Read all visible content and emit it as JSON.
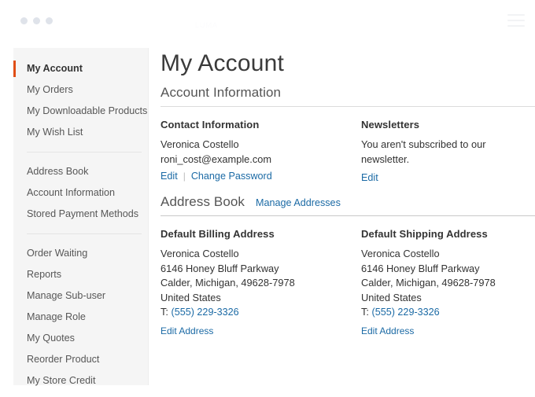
{
  "window": {
    "dots": [
      "dot-1",
      "dot-2",
      "dot-3"
    ],
    "brand_watermark": "LUMA",
    "menu_icon": "hamburger-menu-icon"
  },
  "sidebar": {
    "groups": [
      {
        "items": [
          {
            "label": "My Account",
            "current": true
          },
          {
            "label": "My Orders",
            "current": false
          },
          {
            "label": "My Downloadable Products",
            "current": false
          },
          {
            "label": "My Wish List",
            "current": false
          }
        ]
      },
      {
        "items": [
          {
            "label": "Address Book",
            "current": false
          },
          {
            "label": "Account Information",
            "current": false
          },
          {
            "label": "Stored Payment Methods",
            "current": false
          }
        ]
      },
      {
        "items": [
          {
            "label": "Order Waiting",
            "current": false
          },
          {
            "label": "Reports",
            "current": false
          },
          {
            "label": "Manage Sub-user",
            "current": false
          },
          {
            "label": "Manage Role",
            "current": false
          },
          {
            "label": "My Quotes",
            "current": false
          },
          {
            "label": "Reorder Product",
            "current": false
          },
          {
            "label": "My Store Credit",
            "current": false
          }
        ]
      }
    ]
  },
  "main": {
    "page_title": "My Account",
    "account_information": {
      "section_title": "Account Information",
      "contact": {
        "heading": "Contact Information",
        "name": "Veronica Costello",
        "email": "roni_cost@example.com",
        "edit_label": "Edit",
        "separator": "|",
        "change_password_label": "Change Password"
      },
      "newsletters": {
        "heading": "Newsletters",
        "status": "You aren't subscribed to our newsletter.",
        "edit_label": "Edit"
      }
    },
    "address_book": {
      "section_title": "Address Book",
      "manage_addresses_label": "Manage Addresses",
      "billing": {
        "heading": "Default Billing Address",
        "name": "Veronica Costello",
        "street": "6146 Honey Bluff Parkway",
        "city_region_zip": "Calder, Michigan, 49628-7978",
        "country": "United States",
        "phone_prefix": "T:",
        "phone": "(555) 229-3326",
        "edit_label": "Edit Address"
      },
      "shipping": {
        "heading": "Default Shipping Address",
        "name": "Veronica Costello",
        "street": "6146 Honey Bluff Parkway",
        "city_region_zip": "Calder, Michigan, 49628-7978",
        "country": "United States",
        "phone_prefix": "T:",
        "phone": "(555) 229-3326",
        "edit_label": "Edit Address"
      }
    }
  },
  "colors": {
    "active_accent": "#e04e16",
    "link": "#1b6aa5",
    "sidebar_bg": "#f5f5f5",
    "text": "#333333",
    "muted_text": "#575757",
    "rule": "#c9c9c9"
  }
}
